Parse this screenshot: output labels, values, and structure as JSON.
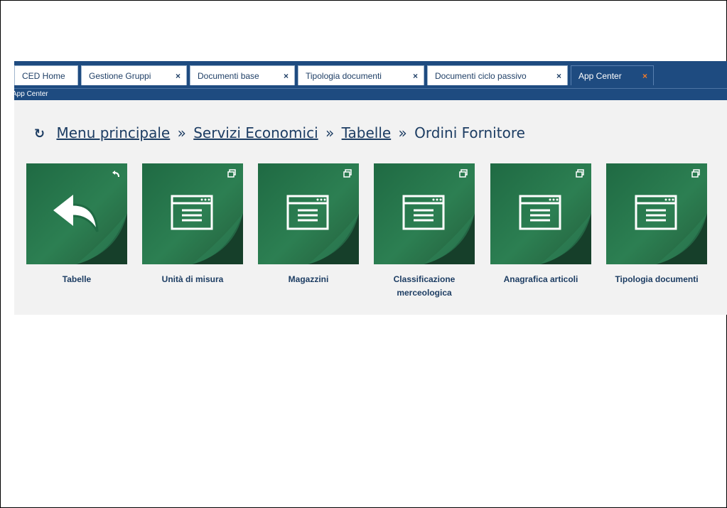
{
  "tabs": [
    {
      "label": "CED Home",
      "closable": false
    },
    {
      "label": "Gestione Gruppi",
      "closable": true
    },
    {
      "label": "Documenti base",
      "closable": true
    },
    {
      "label": "Tipologia documenti",
      "closable": true
    },
    {
      "label": "Documenti ciclo passivo",
      "closable": true
    },
    {
      "label": "App Center",
      "closable": true,
      "active": true
    }
  ],
  "close_glyph": "×",
  "subbar_title": "App Center",
  "breadcrumb": {
    "refresh_glyph": "↻",
    "items": [
      "Menu principale",
      "Servizi Economici",
      "Tabelle"
    ],
    "separator": "»",
    "current": "Ordini Fornitore"
  },
  "tiles": [
    {
      "label": "Tabelle",
      "icon": "back-arrow-icon",
      "corner_icon": "back-corner-icon"
    },
    {
      "label": "Unità di misura",
      "icon": "window-list-icon",
      "corner_icon": "open-window-icon"
    },
    {
      "label": "Magazzini",
      "icon": "window-list-icon",
      "corner_icon": "open-window-icon"
    },
    {
      "label": "Classificazione merceologica",
      "icon": "window-list-icon",
      "corner_icon": "open-window-icon"
    },
    {
      "label": "Anagrafica articoli",
      "icon": "window-list-icon",
      "corner_icon": "open-window-icon"
    },
    {
      "label": "Tipologia documenti",
      "icon": "window-list-icon",
      "corner_icon": "open-window-icon"
    }
  ],
  "colors": {
    "tabbar": "#1e4b80",
    "tile_green": "#2a7a4f",
    "accent_close": "#f07b2a",
    "link": "#1d3d63"
  }
}
